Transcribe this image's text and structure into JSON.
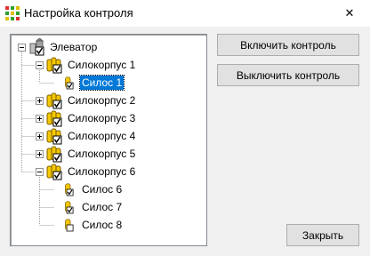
{
  "window": {
    "title": "Настройка контроля",
    "close_glyph": "✕",
    "app_icon": "grid-app-icon"
  },
  "tree": {
    "root": {
      "label": "Элеватор",
      "expanded": true,
      "icon": "elevator-icon"
    },
    "groups": [
      {
        "label": "Силокорпус 1",
        "expanded": true,
        "icon": "silo-group-icon"
      },
      {
        "label": "Силос 1",
        "selected": true,
        "icon": "silo-icon"
      },
      {
        "label": "Силокорпус 2",
        "expanded": false,
        "icon": "silo-group-icon"
      },
      {
        "label": "Силокорпус 3",
        "expanded": false,
        "icon": "silo-group-icon"
      },
      {
        "label": "Силокорпус 4",
        "expanded": false,
        "icon": "silo-group-icon"
      },
      {
        "label": "Силокорпус 5",
        "expanded": false,
        "icon": "silo-group-icon"
      },
      {
        "label": "Силокорпус 6",
        "expanded": true,
        "icon": "silo-group-icon"
      },
      {
        "label": "Силос 6",
        "icon": "silo-icon",
        "checked": true
      },
      {
        "label": "Силос 7",
        "icon": "silo-icon",
        "checked": true
      },
      {
        "label": "Силос 8",
        "icon": "silo-icon",
        "checked": false
      }
    ]
  },
  "buttons": {
    "enable": "Включить контроль",
    "disable": "Выключить контроль",
    "close": "Закрыть"
  },
  "colors": {
    "selection": "#0078d7",
    "accent_yellow": "#f5c800",
    "window_bg": "#f0f0f0"
  }
}
